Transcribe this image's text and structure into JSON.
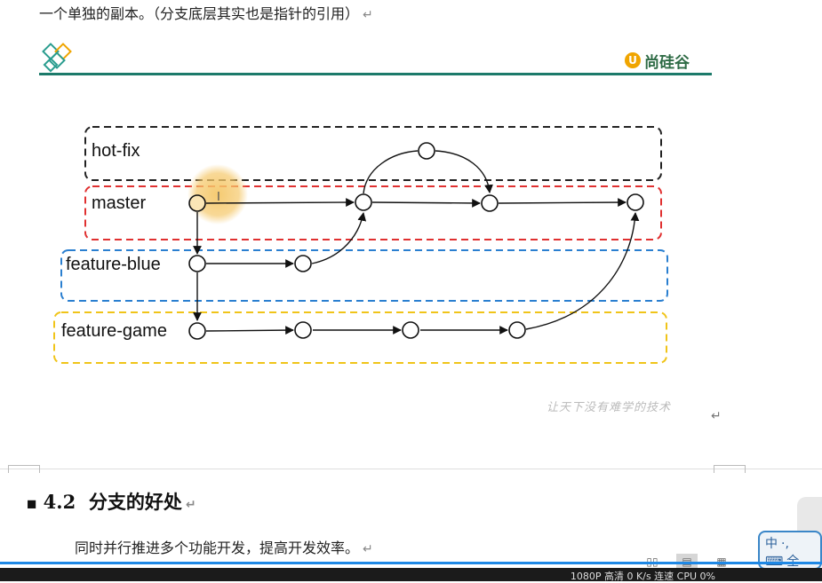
{
  "top_text": "一个单独的副本。（分支底层其实也是指针的引用）",
  "return_mark": "↵",
  "brand": {
    "mark": "U",
    "name": "尚硅谷"
  },
  "lanes": [
    {
      "label": "hot-fix",
      "color": "#222222"
    },
    {
      "label": "master",
      "color": "#e03030"
    },
    {
      "label": "feature-blue",
      "color": "#2a7fd0"
    },
    {
      "label": "feature-game",
      "color": "#f0c419"
    }
  ],
  "watermark": "让天下没有难学的技术",
  "section": {
    "number": "4.2",
    "title": "分支的好处"
  },
  "body": "同时并行推进多个功能开发，提高开发效率。",
  "ime": {
    "lang": "中",
    "punct": "·,",
    "mode": "全"
  },
  "bottom_status": "1080P 高清  0 K/s 连速  CPU 0%",
  "colors": {
    "rule": "#1c7a6a",
    "highlight": "#f5c86a",
    "progress": "#1e88e5"
  }
}
